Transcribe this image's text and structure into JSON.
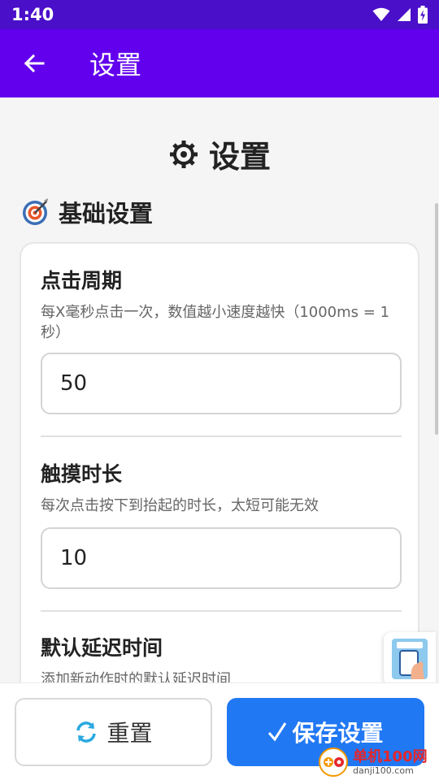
{
  "status_bar": {
    "time": "1:40",
    "icons": [
      "wifi-icon",
      "signal-icon",
      "battery-charging-icon"
    ]
  },
  "app_bar": {
    "title": "设置",
    "back_icon": "arrow-left-icon"
  },
  "page": {
    "heading": "设置",
    "heading_icon": "gear-icon",
    "section": {
      "title": "基础设置",
      "icon": "target-dart-icon"
    }
  },
  "fields": [
    {
      "title": "点击周期",
      "description": "每X毫秒点击一次，数值越小速度越快（1000ms = 1秒）",
      "value": "50"
    },
    {
      "title": "触摸时长",
      "description": "每次点击按下到抬起的时长，太短可能无效",
      "value": "10"
    },
    {
      "title": "默认延迟时间",
      "description": "添加新动作时的默认延迟时间"
    }
  ],
  "buttons": {
    "reset": {
      "label": "重置",
      "icon": "refresh-icon"
    },
    "save": {
      "label": "保存设置",
      "icon": "checkmark-icon"
    }
  },
  "watermark": {
    "name": "单机100网",
    "url": "danji100.com"
  },
  "colors": {
    "status_bar": "#4a0fc9",
    "app_bar": "#6200ee",
    "save_button": "#2178f3",
    "reset_icon": "#29a9e0"
  }
}
